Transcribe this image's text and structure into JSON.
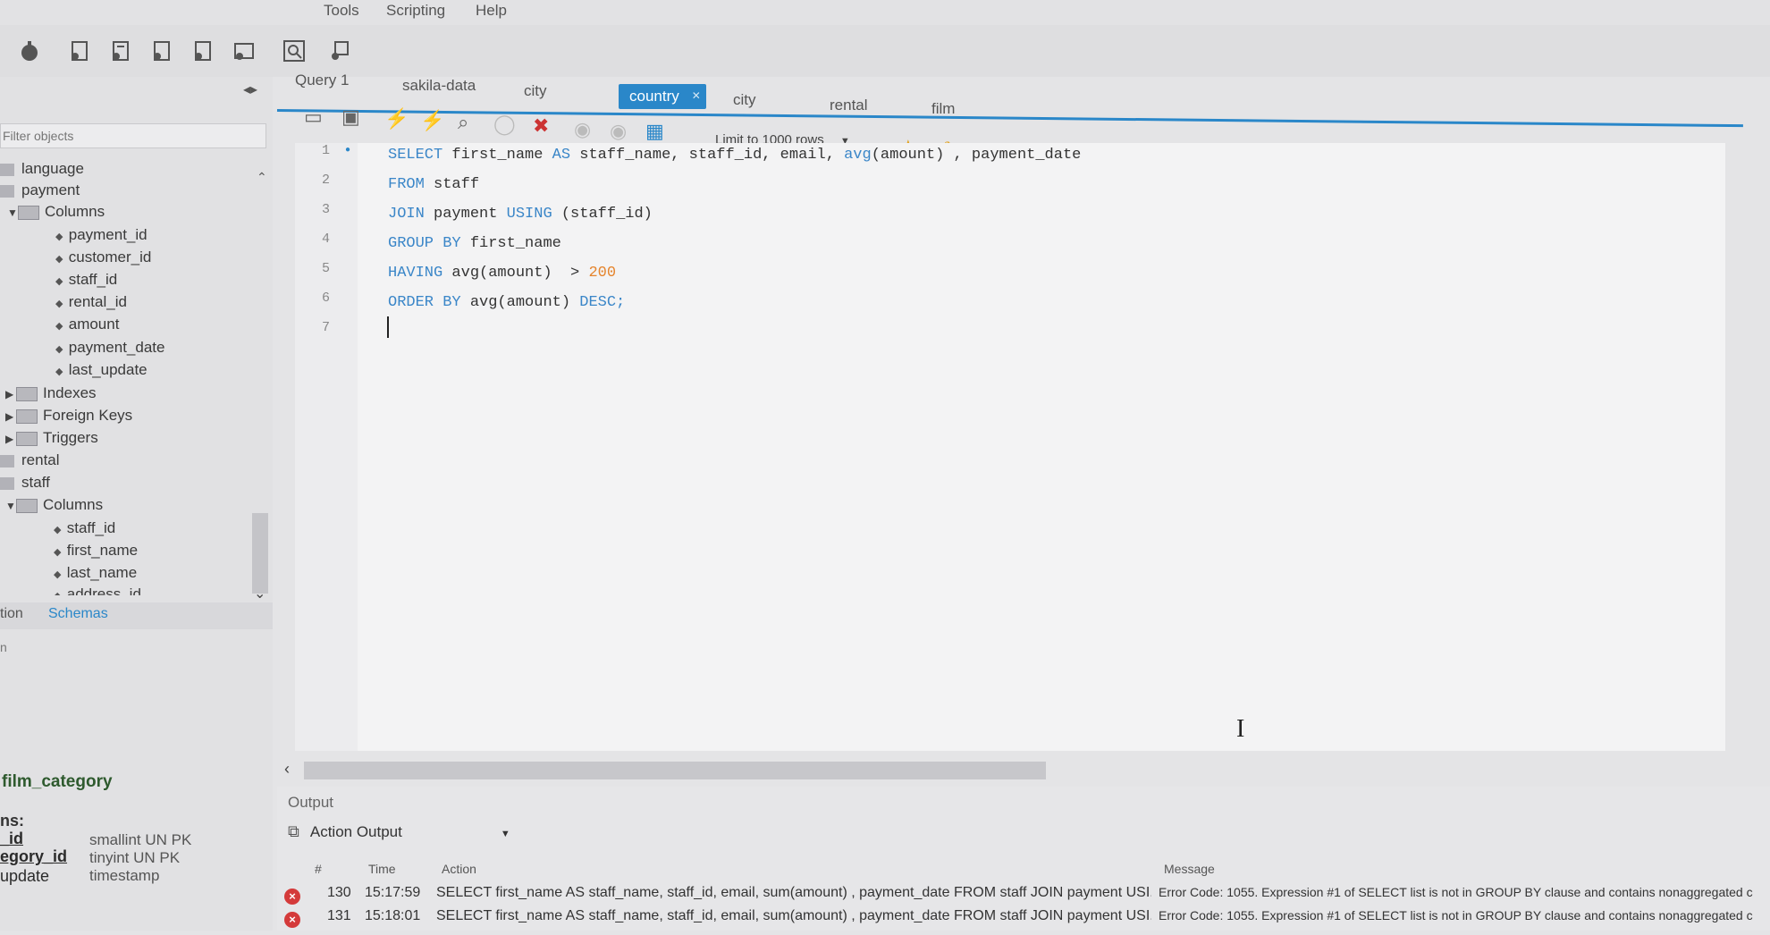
{
  "menu": {
    "items": [
      "Tools",
      "Scripting",
      "Help"
    ]
  },
  "sidebar": {
    "filter_placeholder": "Filter objects",
    "tree": {
      "language": "language",
      "payment": "payment",
      "payment_columns_label": "Columns",
      "payment_columns": [
        "payment_id",
        "customer_id",
        "staff_id",
        "rental_id",
        "amount",
        "payment_date",
        "last_update"
      ],
      "indexes": "Indexes",
      "foreign_keys": "Foreign Keys",
      "triggers": "Triggers",
      "rental": "rental",
      "staff": "staff",
      "staff_columns_label": "Columns",
      "staff_columns": [
        "staff_id",
        "first_name",
        "last_name",
        "address_id"
      ]
    },
    "tabs": {
      "administration": "tion",
      "schemas": "Schemas"
    },
    "info": {
      "heading_fragment": "n",
      "table_name": "film_category",
      "columns_label": "ns:",
      "columns": [
        {
          "name": "_id",
          "type": "smallint UN PK"
        },
        {
          "name": "egory_id",
          "type": "tinyint UN PK"
        },
        {
          "name": "update",
          "type": "timestamp"
        }
      ]
    }
  },
  "editor": {
    "tabs": [
      "Query 1",
      "sakila-data",
      "city",
      "country",
      "city",
      "rental",
      "film"
    ],
    "active_tab_index": 3,
    "limit_label": "Limit to 1000 rows",
    "line_numbers": [
      "1",
      "2",
      "3",
      "4",
      "5",
      "6",
      "7"
    ],
    "code": {
      "l1_kw1": "SELECT",
      "l1_a": " first_name ",
      "l1_kw2": "AS",
      "l1_b": " staff_name, staff_id, email, ",
      "l1_fn": "avg",
      "l1_c": "(amount) , payment_date",
      "l2_kw": "FROM",
      "l2_a": " staff",
      "l3_kw1": "JOIN",
      "l3_a": " payment ",
      "l3_kw2": "USING",
      "l3_b": " (staff_id)",
      "l4_kw": "GROUP BY",
      "l4_a": " first_name",
      "l5_kw": "HAVING",
      "l5_a": " avg(amount)  > ",
      "l5_num": "200",
      "l6_kw": "ORDER BY",
      "l6_a": " avg(amount) ",
      "l6_kw2": "DESC;"
    }
  },
  "output": {
    "header": "Output",
    "select_label": "Action Output",
    "columns": {
      "num": "#",
      "time": "Time",
      "action": "Action",
      "message": "Message"
    },
    "rows": [
      {
        "num": "130",
        "time": "15:17:59",
        "action": "SELECT first_name AS staff_name, staff_id, email, sum(amount) , payment_date FROM staff  JOIN payment USI...",
        "message": "Error Code: 1055. Expression #1 of SELECT list is not in GROUP BY clause and contains nonaggregated c"
      },
      {
        "num": "131",
        "time": "15:18:01",
        "action": "SELECT first_name AS staff_name, staff_id, email, sum(amount) , payment_date FROM staff  JOIN payment USI...",
        "message": "Error Code: 1055. Expression #1 of SELECT list is not in GROUP BY clause and contains nonaggregated c"
      }
    ]
  },
  "colors": {
    "accent": "#2a87c9",
    "keyword": "#3a86c8",
    "number": "#e5842c",
    "error": "#d43a3a"
  }
}
